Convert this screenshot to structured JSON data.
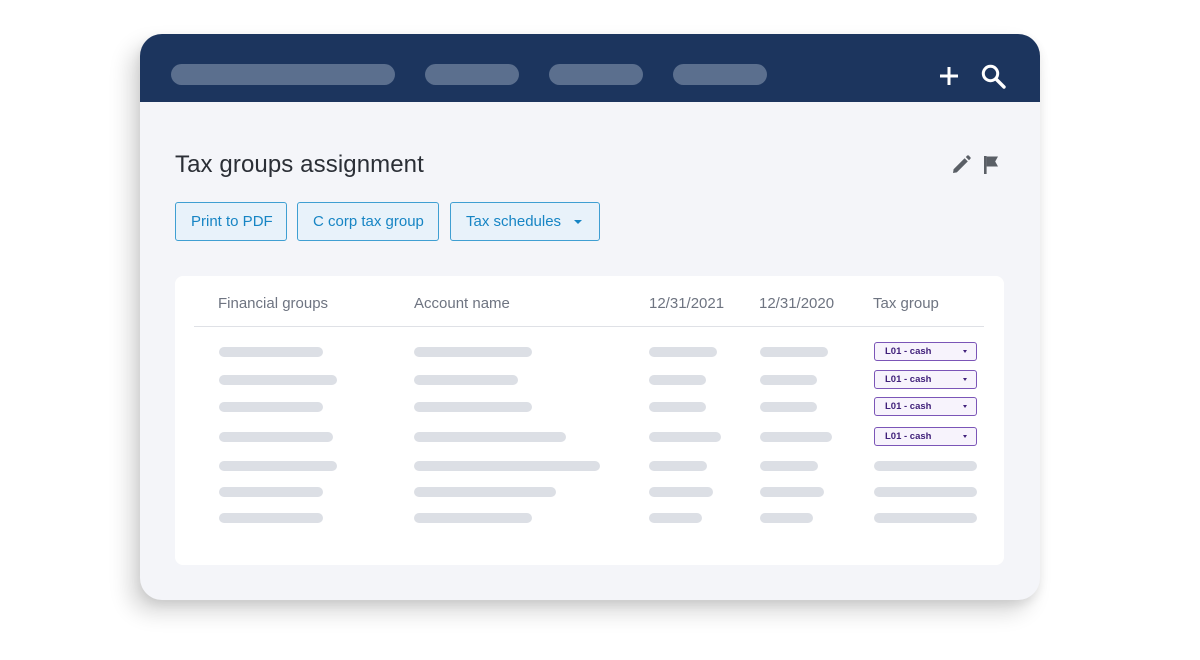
{
  "colors": {
    "topbar": "#1c355e",
    "accent_blue": "#1785c4",
    "tax_group_purple": "#40207a",
    "skeleton": "#dcdfe5"
  },
  "topbar": {
    "icons": [
      "plus-icon",
      "search-icon"
    ]
  },
  "page": {
    "title": "Tax groups assignment",
    "title_icons": [
      "pencil-icon",
      "flag-icon"
    ]
  },
  "toolbar": {
    "print_label": "Print to PDF",
    "corp_label": "C corp tax group",
    "schedules_label": "Tax schedules"
  },
  "table": {
    "columns": [
      "Financial groups",
      "Account name",
      "12/31/2021",
      "12/31/2020",
      "Tax group"
    ],
    "tax_group_values": [
      "L01 - cash",
      "L01 - cash",
      "L01 - cash",
      "L01 - cash"
    ]
  }
}
